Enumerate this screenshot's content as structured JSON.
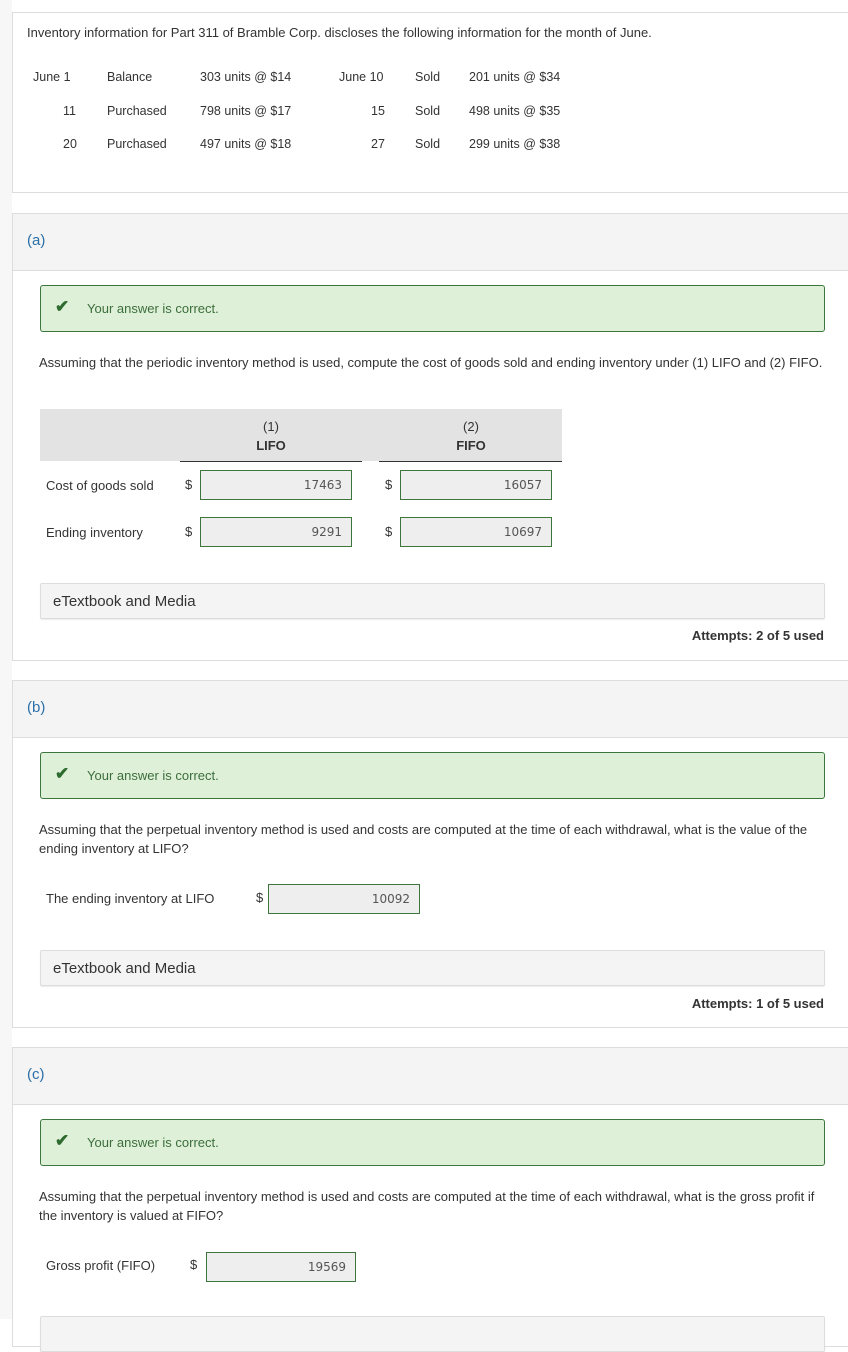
{
  "intro": {
    "text": "Inventory information for Part 311 of Bramble Corp. discloses the following information for the month of June.",
    "rows": [
      {
        "date": "June  1",
        "type": "Balance",
        "detail": "303 units @ $14",
        "date2": "June 10",
        "type2": "Sold",
        "detail2": "201 units @ $34"
      },
      {
        "date": "11",
        "type": "Purchased",
        "detail": "798 units @ $17",
        "date2": "15",
        "type2": "Sold",
        "detail2": "498 units @ $35"
      },
      {
        "date": "20",
        "type": "Purchased",
        "detail": "497 units @ $18",
        "date2": "27",
        "type2": "Sold",
        "detail2": "299 units @ $38"
      }
    ]
  },
  "parts": {
    "a": {
      "label": "(a)",
      "status": "Your answer is correct.",
      "question": "Assuming that the periodic inventory method is used, compute the cost of goods sold and ending inventory under (1) LIFO and (2) FIFO.",
      "columns": [
        {
          "num": "(1)",
          "name": "LIFO"
        },
        {
          "num": "(2)",
          "name": "FIFO"
        }
      ],
      "rows": [
        {
          "label": "Cost of goods sold",
          "currency": "$",
          "lifo": "17463",
          "fifo": "16057"
        },
        {
          "label": "Ending inventory",
          "currency": "$",
          "lifo": "9291",
          "fifo": "10697"
        }
      ],
      "media": "eTextbook and Media",
      "attempts": "Attempts: 2 of 5 used"
    },
    "b": {
      "label": "(b)",
      "status": "Your answer is correct.",
      "question": "Assuming that the perpetual inventory method is used and costs are computed at the time of each withdrawal, what is the value of the ending inventory at LIFO?",
      "field_label": "The ending inventory at LIFO",
      "currency": "$",
      "value": "10092",
      "media": "eTextbook and Media",
      "attempts": "Attempts: 1 of 5 used"
    },
    "c": {
      "label": "(c)",
      "status": "Your answer is correct.",
      "question": "Assuming that the perpetual inventory method is used and costs are computed at the time of each withdrawal, what is the gross profit if the inventory is valued at FIFO?",
      "field_label": "Gross profit (FIFO)",
      "currency": "$",
      "value": "19569"
    }
  },
  "colors": {
    "correct_bg": "#dff0d8",
    "correct_border": "#3c763d",
    "part_label": "#2a6fa8"
  }
}
